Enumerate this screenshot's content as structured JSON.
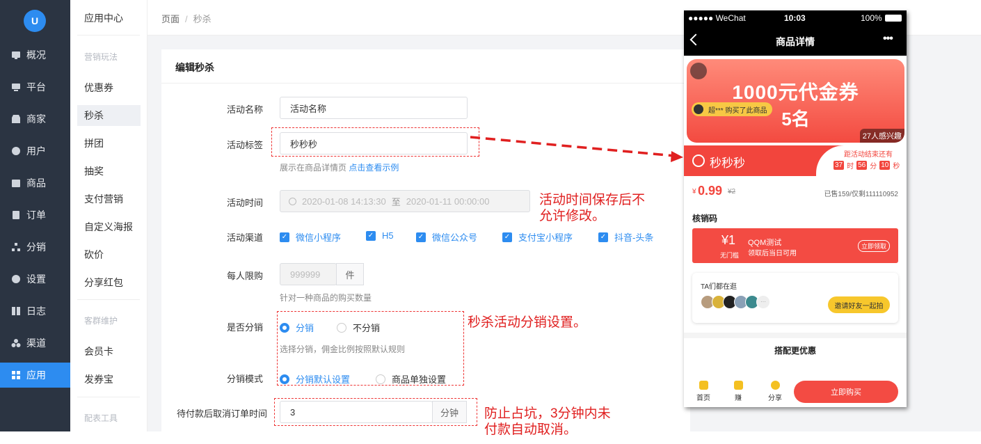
{
  "sidebar": {
    "logo": "U",
    "items": [
      {
        "label": "概况",
        "icon": "chart-icon"
      },
      {
        "label": "平台",
        "icon": "monitor-icon"
      },
      {
        "label": "商家",
        "icon": "store-icon"
      },
      {
        "label": "用户",
        "icon": "user-icon"
      },
      {
        "label": "商品",
        "icon": "bag-icon"
      },
      {
        "label": "订单",
        "icon": "clipboard-icon"
      },
      {
        "label": "分销",
        "icon": "hierarchy-icon"
      },
      {
        "label": "设置",
        "icon": "gear-icon"
      },
      {
        "label": "日志",
        "icon": "book-icon"
      },
      {
        "label": "渠道",
        "icon": "cluster-icon"
      },
      {
        "label": "应用",
        "icon": "grid-icon"
      }
    ]
  },
  "submenu": {
    "title": "应用中心",
    "group1": "营销玩法",
    "items1": [
      "优惠券",
      "秒杀",
      "拼团",
      "抽奖",
      "支付营销",
      "自定义海报",
      "砍价",
      "分享红包"
    ],
    "group2": "客群维护",
    "items2": [
      "会员卡",
      "发券宝"
    ],
    "group3": "配表工具"
  },
  "breadcrumb": {
    "root": "页面",
    "sep": "/",
    "current": "秒杀"
  },
  "form": {
    "title": "编辑秒杀",
    "name_label": "活动名称",
    "name_value": "活动名称",
    "tag_label": "活动标签",
    "tag_value": "秒秒秒",
    "tag_hint": "展示在商品详情页",
    "tag_hint_link": "点击查看示例",
    "time_label": "活动时间",
    "time_start": "2020-01-08 14:13:30",
    "time_to": "至",
    "time_end": "2020-01-11 00:00:00",
    "channel_label": "活动渠道",
    "channels": [
      "微信小程序",
      "H5",
      "微信公众号",
      "支付宝小程序",
      "抖音-头条"
    ],
    "limit_label": "每人限购",
    "limit_placeholder": "999999",
    "limit_unit": "件",
    "limit_hint": "针对一种商品的购买数量",
    "dist_label": "是否分销",
    "dist_on": "分销",
    "dist_off": "不分销",
    "dist_hint": "选择分销，佣金比例按照默认规则",
    "mode_label": "分销模式",
    "mode_default": "分销默认设置",
    "mode_single": "商品单独设置",
    "cancel_label": "待付款后取消订单时间",
    "cancel_value": "3",
    "cancel_unit": "分钟"
  },
  "annotations": {
    "time_note_1": "活动时间保存后不",
    "time_note_2": "允许修改。",
    "dist_note": "秒杀活动分销设置。",
    "cancel_note_1": "防止占坑，3分钟内未",
    "cancel_note_2": "付款自动取消。"
  },
  "phone": {
    "carrier": "●●●●● WeChat",
    "time": "10:03",
    "battery": "100%",
    "title": "商品详情",
    "more": "•••",
    "banner_title": "1000元代金券",
    "banner_buyer": "超*** 购买了此商品",
    "banner_count": "5名",
    "banner_interest": "27人感兴趣",
    "flash_tag": "秒秒秒",
    "countdown_label": "距活动结束还有",
    "cd_h": "37",
    "cd_h_unit": "时",
    "cd_m": "56",
    "cd_m_unit": "分",
    "cd_s": "10",
    "cd_s_unit": "秒",
    "price_symbol": "¥",
    "price": "0.99",
    "orig_price": "¥2",
    "sold": "已售159/仅剩111110952",
    "section_verify": "核销码",
    "coupon_value": "¥1",
    "coupon_cond": "无门槛",
    "coupon_title": "QQM测试",
    "coupon_desc": "领取后当日可用",
    "coupon_btn": "立即领取",
    "together_title": "TA们都在逛",
    "invite_btn": "邀请好友一起拍",
    "avatar_more": "···",
    "combo_title": "搭配更优惠",
    "tabs": [
      "首页",
      "赚",
      "分享"
    ],
    "buy_btn": "立即购买"
  },
  "colors": {
    "accent": "#2d8cf0",
    "sidebar": "#2b3442",
    "annotation": "#e02020",
    "phone_red": "#f34b43"
  }
}
